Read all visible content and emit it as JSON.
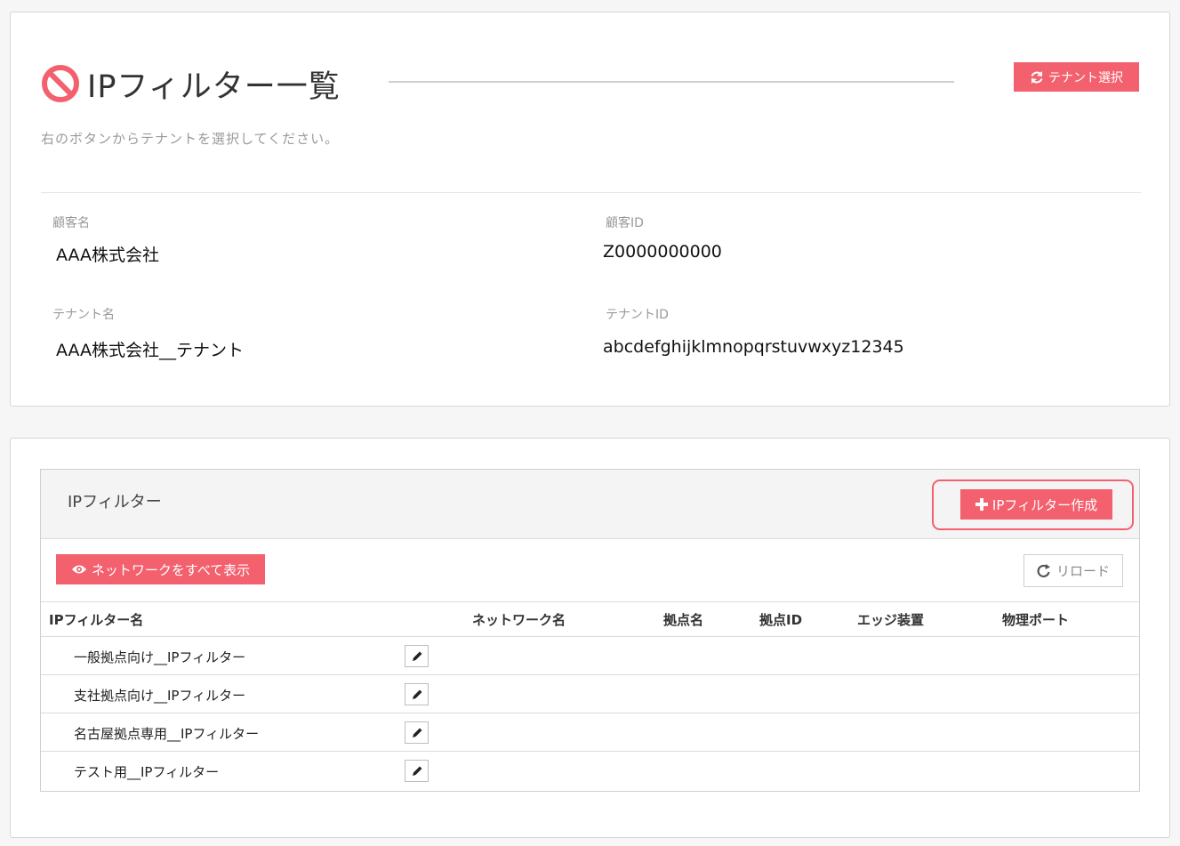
{
  "header": {
    "title": "IPフィルター一覧",
    "subtitle": "右のボタンからテナントを選択してください。",
    "tenant_button": "テナント選択"
  },
  "info": {
    "customer_name_label": "顧客名",
    "customer_name": "AAA株式会社",
    "customer_id_label": "顧客ID",
    "customer_id": "Z0000000000",
    "tenant_name_label": "テナント名",
    "tenant_name": "AAA株式会社__テナント",
    "tenant_id_label": "テナントID",
    "tenant_id": "abcdefghijklmnopqrstuvwxyz12345"
  },
  "panel": {
    "title": "IPフィルター",
    "create_button": "IPフィルター作成",
    "show_network_button": "ネットワークをすべて表示",
    "reload_button": "リロード"
  },
  "table": {
    "columns": [
      "IPフィルター名",
      "ネットワーク名",
      "拠点名",
      "拠点ID",
      "エッジ装置",
      "物理ポート"
    ],
    "rows": [
      {
        "name": "一般拠点向け__IPフィルター"
      },
      {
        "name": "支社拠点向け__IPフィルター"
      },
      {
        "name": "名古屋拠点専用__IPフィルター"
      },
      {
        "name": "テスト用__IPフィルター"
      }
    ]
  },
  "colors": {
    "accent": "#f3606e",
    "border": "#d6d6d6",
    "header_bg": "#f4f4f4"
  },
  "icons": {
    "title_icon": "ban-icon",
    "tenant_button_icon": "refresh-icon",
    "create_button_icon": "plus-icon",
    "show_network_icon": "eye-icon",
    "reload_icon": "reload-icon",
    "edit_icon": "pencil-icon"
  }
}
